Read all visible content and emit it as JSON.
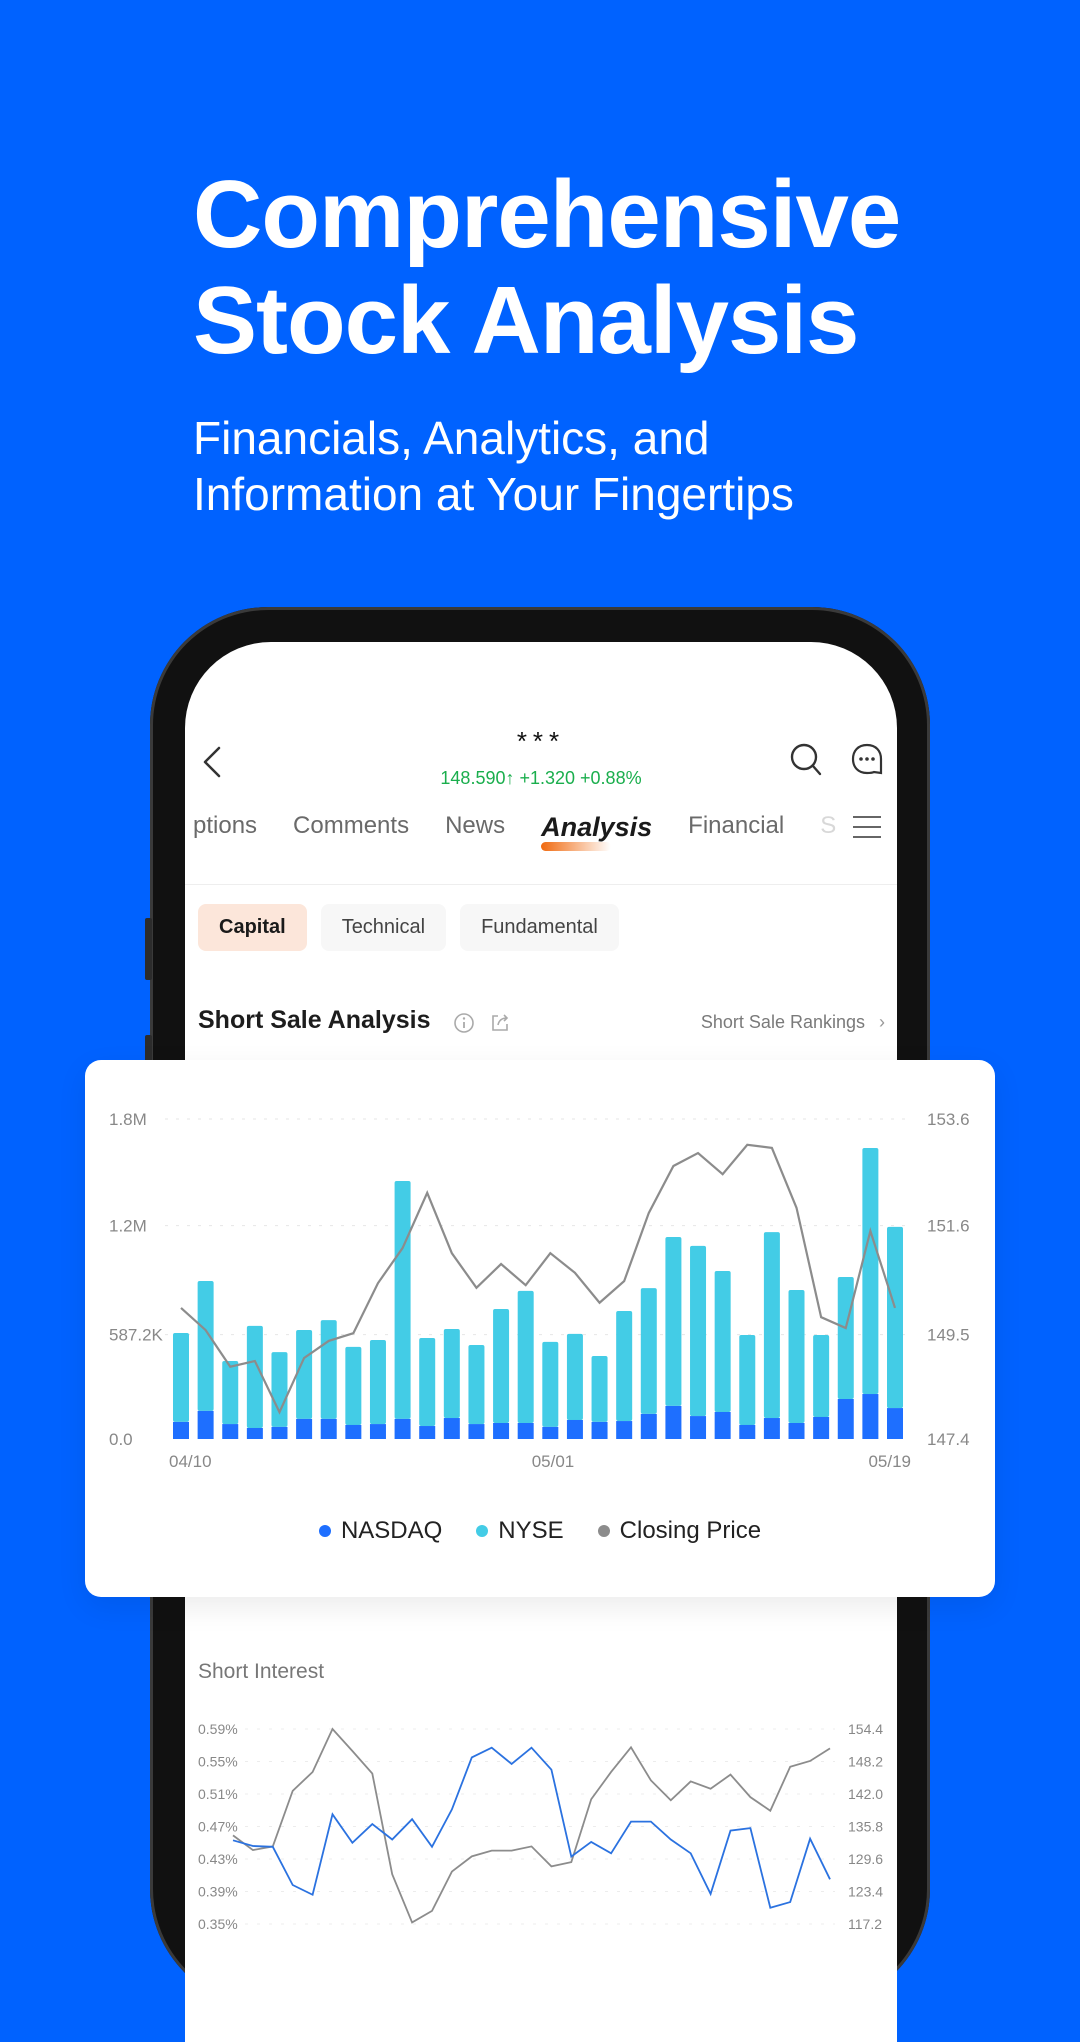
{
  "hero": {
    "title_line1": "Comprehensive",
    "title_line2": "Stock Analysis",
    "subtitle_line1": "Financials, Analytics, and",
    "subtitle_line2": "Information at Your Fingertips"
  },
  "colors": {
    "background": "#0062FF",
    "up_green": "#1AAE4D",
    "accent_orange": "#F06A10",
    "nasdaq": "#1E6FFF",
    "nyse": "#43CCE6",
    "closing_price": "#8C8C8C",
    "short_interest": "#2B72E0"
  },
  "header": {
    "ticker": "***",
    "quote": "148.590↑ +1.320 +0.88%",
    "icons": [
      "back-arrow-icon",
      "search-icon",
      "chat-icon",
      "menu-icon"
    ]
  },
  "tabs": [
    {
      "label": "ptions",
      "state": "clipped"
    },
    {
      "label": "Comments",
      "state": "normal"
    },
    {
      "label": "News",
      "state": "normal"
    },
    {
      "label": "Analysis",
      "state": "active"
    },
    {
      "label": "Financial",
      "state": "normal"
    },
    {
      "label": "S",
      "state": "faded"
    }
  ],
  "chips": [
    {
      "label": "Capital",
      "active": true
    },
    {
      "label": "Technical",
      "active": false
    },
    {
      "label": "Fundamental",
      "active": false
    }
  ],
  "section": {
    "title": "Short Sale Analysis",
    "link": "Short Sale Rankings",
    "link_chevron": "›"
  },
  "legend": [
    {
      "label": "NASDAQ",
      "color": "#1E6FFF"
    },
    {
      "label": "NYSE",
      "color": "#43CCE6"
    },
    {
      "label": "Closing Price",
      "color": "#8C8C8C"
    }
  ],
  "short_interest": {
    "title": "Short Interest"
  },
  "chart_data": [
    {
      "type": "bar",
      "title": "Short Sale Analysis",
      "stacked": true,
      "x_tick_labels": [
        "04/10",
        "05/01",
        "05/19"
      ],
      "left_axis": {
        "ticks": [
          "0.0",
          "587.2K",
          "1.2M",
          "1.8M"
        ],
        "range": [
          0,
          1800000
        ]
      },
      "right_axis": {
        "ticks": [
          "147.4",
          "149.5",
          "151.6",
          "153.6"
        ],
        "range": [
          147.4,
          153.6
        ]
      },
      "grid": "dashed-horizontal",
      "legend_position": "bottom-center",
      "series": [
        {
          "name": "NASDAQ",
          "kind": "bar",
          "axis": "left",
          "values": [
            96000,
            158000,
            84000,
            62000,
            68000,
            113000,
            113000,
            79000,
            84000,
            113000,
            73000,
            118000,
            84000,
            90000,
            90000,
            68000,
            107000,
            96000,
            101000,
            141000,
            186000,
            129000,
            152000,
            79000,
            118000,
            90000,
            124000,
            225000,
            253000,
            174000
          ]
        },
        {
          "name": "NYSE",
          "kind": "bar",
          "axis": "left",
          "values": [
            500000,
            731000,
            355000,
            574000,
            421000,
            500000,
            556000,
            439000,
            473000,
            1338000,
            495000,
            501000,
            445000,
            641000,
            743000,
            478000,
            484000,
            371000,
            619000,
            708000,
            950000,
            957000,
            793000,
            506000,
            1046000,
            748000,
            461000,
            686000,
            1384000,
            1019000
          ]
        },
        {
          "name": "Closing Price",
          "kind": "line",
          "axis": "right",
          "values": [
            149.94,
            149.51,
            148.8,
            148.91,
            147.92,
            148.97,
            149.3,
            149.45,
            150.42,
            151.1,
            152.17,
            151.0,
            150.33,
            150.79,
            150.38,
            151.0,
            150.62,
            150.04,
            150.46,
            151.78,
            152.69,
            152.94,
            152.53,
            153.1,
            153.04,
            151.88,
            149.76,
            149.55,
            151.43,
            149.94
          ]
        }
      ]
    },
    {
      "type": "line",
      "title": "Short Interest",
      "left_axis": {
        "ticks": [
          "0.59%",
          "0.55%",
          "0.51%",
          "0.47%",
          "0.43%",
          "0.39%",
          "0.35%"
        ],
        "range": [
          0.35,
          0.59
        ],
        "unit": "%"
      },
      "right_axis": {
        "ticks": [
          "154.4",
          "148.2",
          "142.0",
          "135.8",
          "129.6",
          "123.4",
          "117.2"
        ],
        "range": [
          117.2,
          154.4
        ]
      },
      "grid": "dashed-horizontal",
      "series": [
        {
          "name": "Short Interest %",
          "axis": "left",
          "values": [
            0.453,
            0.446,
            0.445,
            0.398,
            0.386,
            0.485,
            0.45,
            0.473,
            0.454,
            0.479,
            0.445,
            0.491,
            0.555,
            0.567,
            0.547,
            0.567,
            0.54,
            0.433,
            0.451,
            0.437,
            0.476,
            0.476,
            0.454,
            0.437,
            0.387,
            0.465,
            0.468,
            0.37,
            0.377,
            0.455,
            0.405
          ]
        },
        {
          "name": "Closing Price",
          "axis": "right",
          "values": [
            134.1,
            131.3,
            132.0,
            142.6,
            146.2,
            154.4,
            150.2,
            145.9,
            126.7,
            117.5,
            119.7,
            127.2,
            130.1,
            131.2,
            131.2,
            132.0,
            128.2,
            129.0,
            141.0,
            146.2,
            150.9,
            144.6,
            140.8,
            144.4,
            143.0,
            145.7,
            141.4,
            138.8,
            147.2,
            148.3,
            150.7
          ]
        }
      ]
    }
  ]
}
